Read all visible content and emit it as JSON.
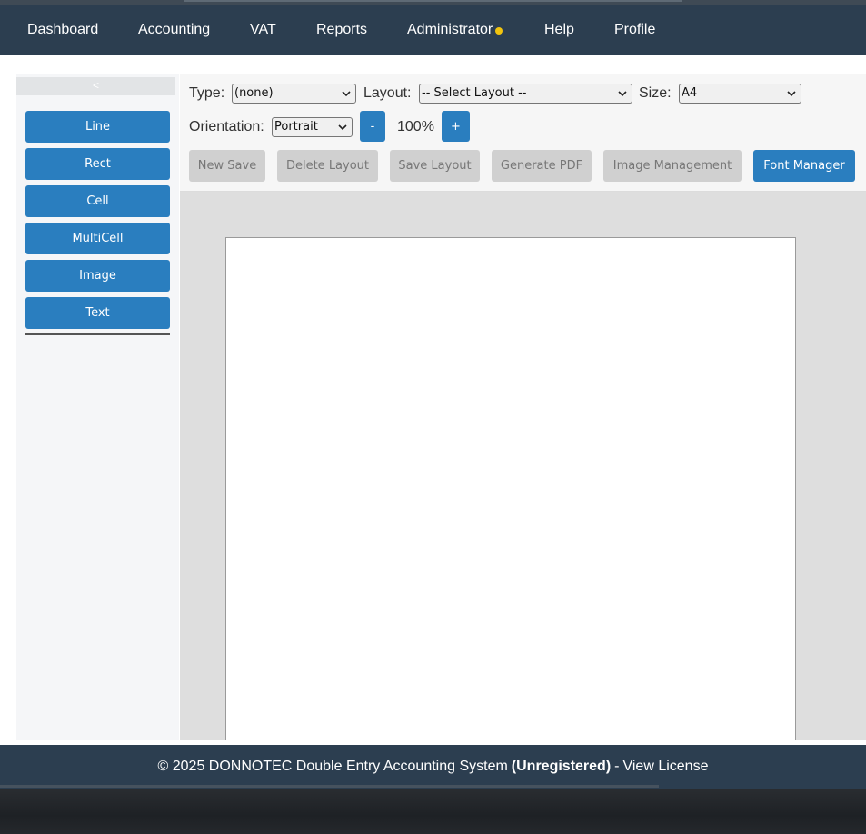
{
  "nav": {
    "items": [
      "Dashboard",
      "Accounting",
      "VAT",
      "Reports",
      "Administrator",
      "Help",
      "Profile"
    ],
    "notification_color": "#f1c40f"
  },
  "sidebar": {
    "collapse_label": "<",
    "buttons": [
      "Line",
      "Rect",
      "Cell",
      "MultiCell",
      "Image",
      "Text"
    ]
  },
  "toolbar": {
    "type_label": "Type:",
    "type_value": "(none)",
    "layout_label": "Layout:",
    "layout_value": "-- Select Layout --",
    "size_label": "Size:",
    "size_value": "A4",
    "orientation_label": "Orientation:",
    "orientation_value": "Portrait",
    "zoom_out": "-",
    "zoom_level": "100%",
    "zoom_in": "+",
    "actions": {
      "new_save": "New Save",
      "delete_layout": "Delete Layout",
      "save_layout": "Save Layout",
      "generate_pdf": "Generate PDF",
      "image_management": "Image Management",
      "font_manager": "Font Manager"
    }
  },
  "footer": {
    "copyright": "© 2025 DONNOTEC Double Entry Accounting System",
    "status": "(Unregistered)",
    "separator": "-",
    "license_link": "View License"
  },
  "colors": {
    "navbar": "#2c3e50",
    "accent": "#2a7ebf",
    "disabled_button": "#d0d0d0"
  }
}
